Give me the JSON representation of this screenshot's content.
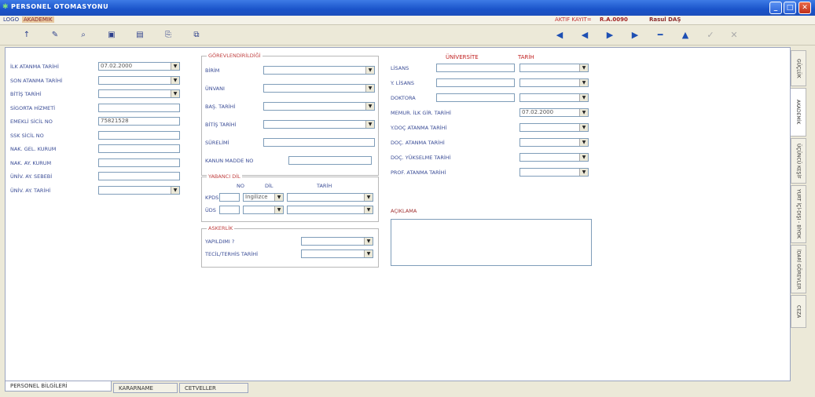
{
  "window": {
    "title": "PERSONEL OTOMASYONU",
    "min": "_",
    "max": "□",
    "close": "✕"
  },
  "menu": {
    "logo": "LOGO",
    "akademik": "AKADEMIK",
    "aktif": "AKTIF KAYIT=",
    "kayit_no": "R.A.0090",
    "user": "Rasul DAŞ"
  },
  "toolbar": [
    "↑",
    "✎",
    "⌕",
    "▣",
    "▤",
    "⎘",
    "⧉"
  ],
  "nav": [
    "◀",
    "◀",
    "▶",
    "▶",
    "━",
    "▲",
    "✓",
    "✕"
  ],
  "left": [
    {
      "label": "İLK ATANMA TARİHİ",
      "value": "07.02.2000",
      "dd": true
    },
    {
      "label": "SON ATANMA TARİHİ",
      "value": "",
      "dd": true
    },
    {
      "label": "BİTİŞ TARİHİ",
      "value": "",
      "dd": true
    },
    {
      "label": "SİGORTA HİZMETİ",
      "value": "",
      "dd": false
    },
    {
      "label": "EMEKLİ SİCİL NO",
      "value": "75821528",
      "dd": false
    },
    {
      "label": "SSK SİCİL NO",
      "value": "",
      "dd": false
    },
    {
      "label": "NAK. GEL. KURUM",
      "value": "",
      "dd": false
    },
    {
      "label": "NAK. AY. KURUM",
      "value": "",
      "dd": false
    },
    {
      "label": "ÜNİV. AY. SEBEBİ",
      "value": "",
      "dd": false
    },
    {
      "label": "ÜNİV. AY. TARİHİ",
      "value": "",
      "dd": true
    }
  ],
  "gorev": {
    "title": "GÖREVLENDİRİLDİĞİ",
    "rows": [
      {
        "label": "BİRİM",
        "value": "",
        "dd": true
      },
      {
        "label": "ÜNVANI",
        "value": "",
        "dd": true
      },
      {
        "label": "BAŞ. TARİHİ",
        "value": "",
        "dd": true
      },
      {
        "label": "BİTİŞ TARİHİ",
        "value": "",
        "dd": true
      },
      {
        "label": "SÜRELİMİ",
        "value": "",
        "dd": false
      },
      {
        "label": "KANUN MADDE NO",
        "value": "",
        "dd": false
      }
    ]
  },
  "yabanci": {
    "title": "YABANCI DİL",
    "h_no": "NO",
    "h_dil": "DİL",
    "h_tarih": "TARİH",
    "rows": [
      {
        "label": "KPDS",
        "no": "",
        "dil": "İngilizce",
        "tarih": ""
      },
      {
        "label": "ÜDS",
        "no": "",
        "dil": "",
        "tarih": ""
      }
    ]
  },
  "askerlik": {
    "title": "ASKERLİK",
    "rows": [
      {
        "label": "YAPILDIMI ?",
        "value": ""
      },
      {
        "label": "TECİL/TERHİS TARİHİ",
        "value": ""
      }
    ]
  },
  "right": {
    "h_univ": "ÜNİVERSİTE",
    "h_tarih": "TARİH",
    "rows": [
      {
        "label": "LİSANS",
        "univ": true,
        "value": ""
      },
      {
        "label": "Y. LİSANS",
        "univ": true,
        "value": ""
      },
      {
        "label": "DOKTORA",
        "univ": true,
        "value": ""
      },
      {
        "label": "MEMUR. İLK GİR. TARİHİ",
        "univ": false,
        "value": "07.02.2000"
      },
      {
        "label": "Y.DOÇ ATANMA TARİHİ",
        "univ": false,
        "value": ""
      },
      {
        "label": "DOÇ. ATANMA TARİHİ",
        "univ": false,
        "value": ""
      },
      {
        "label": "DOÇ. YÜKSELME TARİHİ",
        "univ": false,
        "value": ""
      },
      {
        "label": "PROF. ATANMA TARİHİ",
        "univ": false,
        "value": ""
      }
    ],
    "aciklama": "AÇIKLAMA"
  },
  "vtabs": [
    "GÜÇLÜK",
    "AKADEMİK",
    "ÜÇÜNCÜ KEŞİF",
    "YURT İÇİ-DIŞI - BİYOK",
    "İDARİ GÖREVLER",
    "CEZA"
  ],
  "btabs": [
    "PERSONEL BİLGİLERİ",
    "KARARNAME",
    "CETVELLER"
  ]
}
